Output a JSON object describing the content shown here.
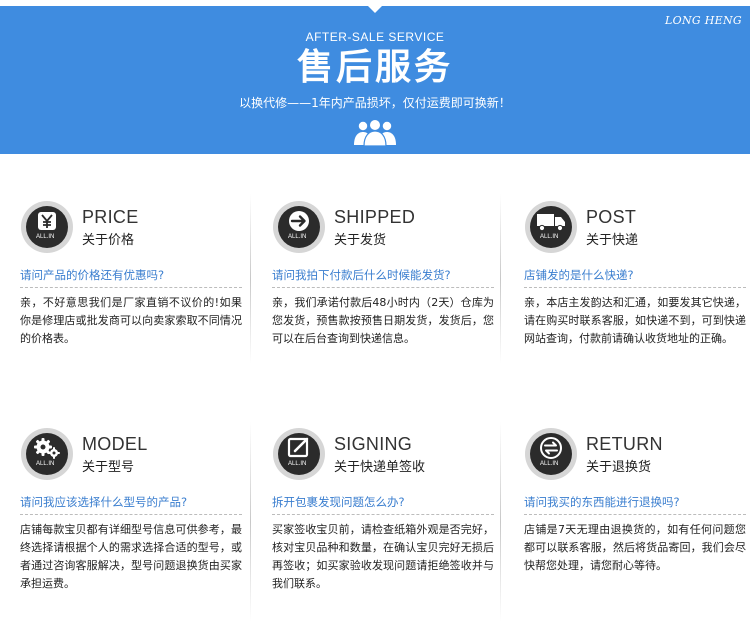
{
  "banner": {
    "brand": "LONG HENG",
    "subtitle_en": "AFTER-SALE SERVICE",
    "title_zh": "售后服务",
    "slogan": "以换代修——1年内产品损坏，仅付运费即可换新！",
    "icon": "people-group-icon",
    "bg_color": "#3f8ce0"
  },
  "badge_label": "ALL.IN",
  "colors": {
    "question": "#3a7ecf",
    "badge_ring": "#d6d6d6",
    "badge_core": "#2b2b2b"
  },
  "items": [
    {
      "key": "price",
      "icon": "yen-icon",
      "title_en": "PRICE",
      "title_zh": "关于价格",
      "question": "请问产品的价格还有优惠吗?",
      "answer": "亲，不好意思我们是厂家直销不议价的!如果你是修理店或批发商可以向卖家索取不同情况的价格表。"
    },
    {
      "key": "shipped",
      "icon": "arrow-right-icon",
      "title_en": "SHIPPED",
      "title_zh": "关于发货",
      "question": "请问我拍下付款后什么时候能发货?",
      "answer": "亲，我们承诺付款后48小时内（2天）仓库为您发货，预售款按预售日期发货，发货后，您可以在后台查询到快递信息。"
    },
    {
      "key": "post",
      "icon": "truck-icon",
      "title_en": "POST",
      "title_zh": "关于快递",
      "question": "店铺发的是什么快递?",
      "answer": "亲，本店主发韵达和汇通，如要发其它快递，请在购买时联系客服，如快递不到，可到快递网站查询，付款前请确认收货地址的正确。"
    },
    {
      "key": "model",
      "icon": "gears-icon",
      "title_en": "MODEL",
      "title_zh": "关于型号",
      "question": "请问我应该选择什么型号的产品?",
      "answer": "店铺每款宝贝都有详细型号信息可供参考，最终选择请根据个人的需求选择合适的型号，或者通过咨询客服解决，型号问题退换货由买家承担运费。"
    },
    {
      "key": "signing",
      "icon": "edit-note-icon",
      "title_en": "SIGNING",
      "title_zh": "关于快递单签收",
      "question": "拆开包裹发现问题怎么办?",
      "answer": "买家签收宝贝前，请检查纸箱外观是否完好，核对宝贝品种和数量，在确认宝贝完好无损后再签收；如买家验收发现问题请拒绝签收并与我们联系。"
    },
    {
      "key": "return",
      "icon": "exchange-arrows-icon",
      "title_en": "RETURN",
      "title_zh": "关于退换货",
      "question": "请问我买的东西能进行退换吗?",
      "answer": "店铺是7天无理由退换货的，如有任何问题您都可以联系客服，然后将货品寄回，我们会尽快帮您处理，请您耐心等待。"
    }
  ]
}
